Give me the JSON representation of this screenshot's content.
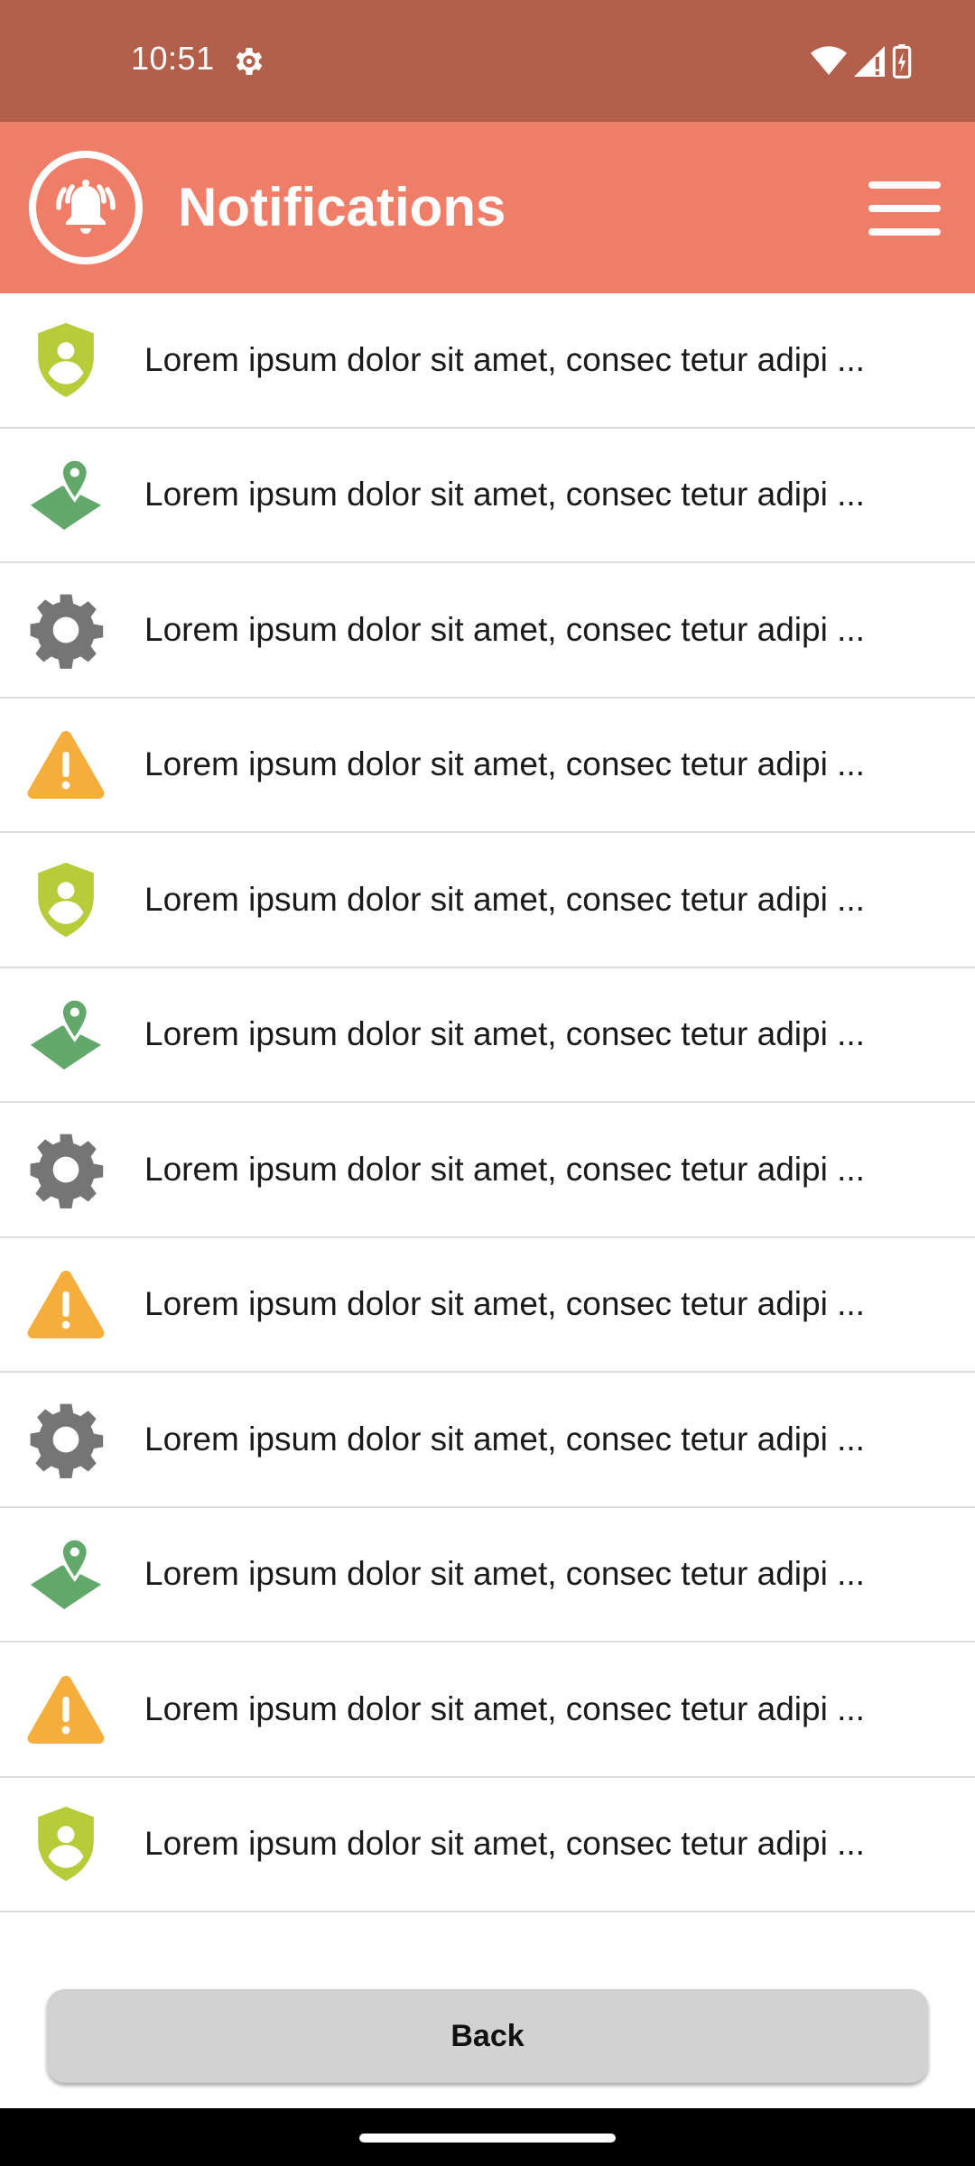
{
  "status_bar": {
    "time": "10:51"
  },
  "header": {
    "title": "Notifications",
    "logo_icon": "alarm-bell-icon",
    "menu_icon": "hamburger-menu-icon",
    "background": "#f07d67"
  },
  "notifications": [
    {
      "icon": "shield-user-icon",
      "color": "#b8cc3a",
      "text": "Lorem ipsum dolor sit amet, consec tetur adipi ..."
    },
    {
      "icon": "map-pin-icon",
      "color": "#63a86b",
      "text": "Lorem ipsum dolor sit amet, consec tetur adipi ..."
    },
    {
      "icon": "gear-icon",
      "color": "#757575",
      "text": "Lorem ipsum dolor sit amet, consec tetur adipi ..."
    },
    {
      "icon": "warning-icon",
      "color": "#f5ad3c",
      "text": "Lorem ipsum dolor sit amet, consec tetur adipi ..."
    },
    {
      "icon": "shield-user-icon",
      "color": "#b8cc3a",
      "text": "Lorem ipsum dolor sit amet, consec tetur adipi ..."
    },
    {
      "icon": "map-pin-icon",
      "color": "#63a86b",
      "text": "Lorem ipsum dolor sit amet, consec tetur adipi ..."
    },
    {
      "icon": "gear-icon",
      "color": "#757575",
      "text": "Lorem ipsum dolor sit amet, consec tetur adipi ..."
    },
    {
      "icon": "warning-icon",
      "color": "#f5ad3c",
      "text": "Lorem ipsum dolor sit amet, consec tetur adipi ..."
    },
    {
      "icon": "gear-icon",
      "color": "#757575",
      "text": "Lorem ipsum dolor sit amet, consec tetur adipi ..."
    },
    {
      "icon": "map-pin-icon",
      "color": "#63a86b",
      "text": "Lorem ipsum dolor sit amet, consec tetur adipi ..."
    },
    {
      "icon": "warning-icon",
      "color": "#f5ad3c",
      "text": "Lorem ipsum dolor sit amet, consec tetur adipi ..."
    },
    {
      "icon": "shield-user-icon",
      "color": "#b8cc3a",
      "text": "Lorem ipsum dolor sit amet, consec tetur adipi ..."
    }
  ],
  "footer": {
    "back_label": "Back"
  }
}
